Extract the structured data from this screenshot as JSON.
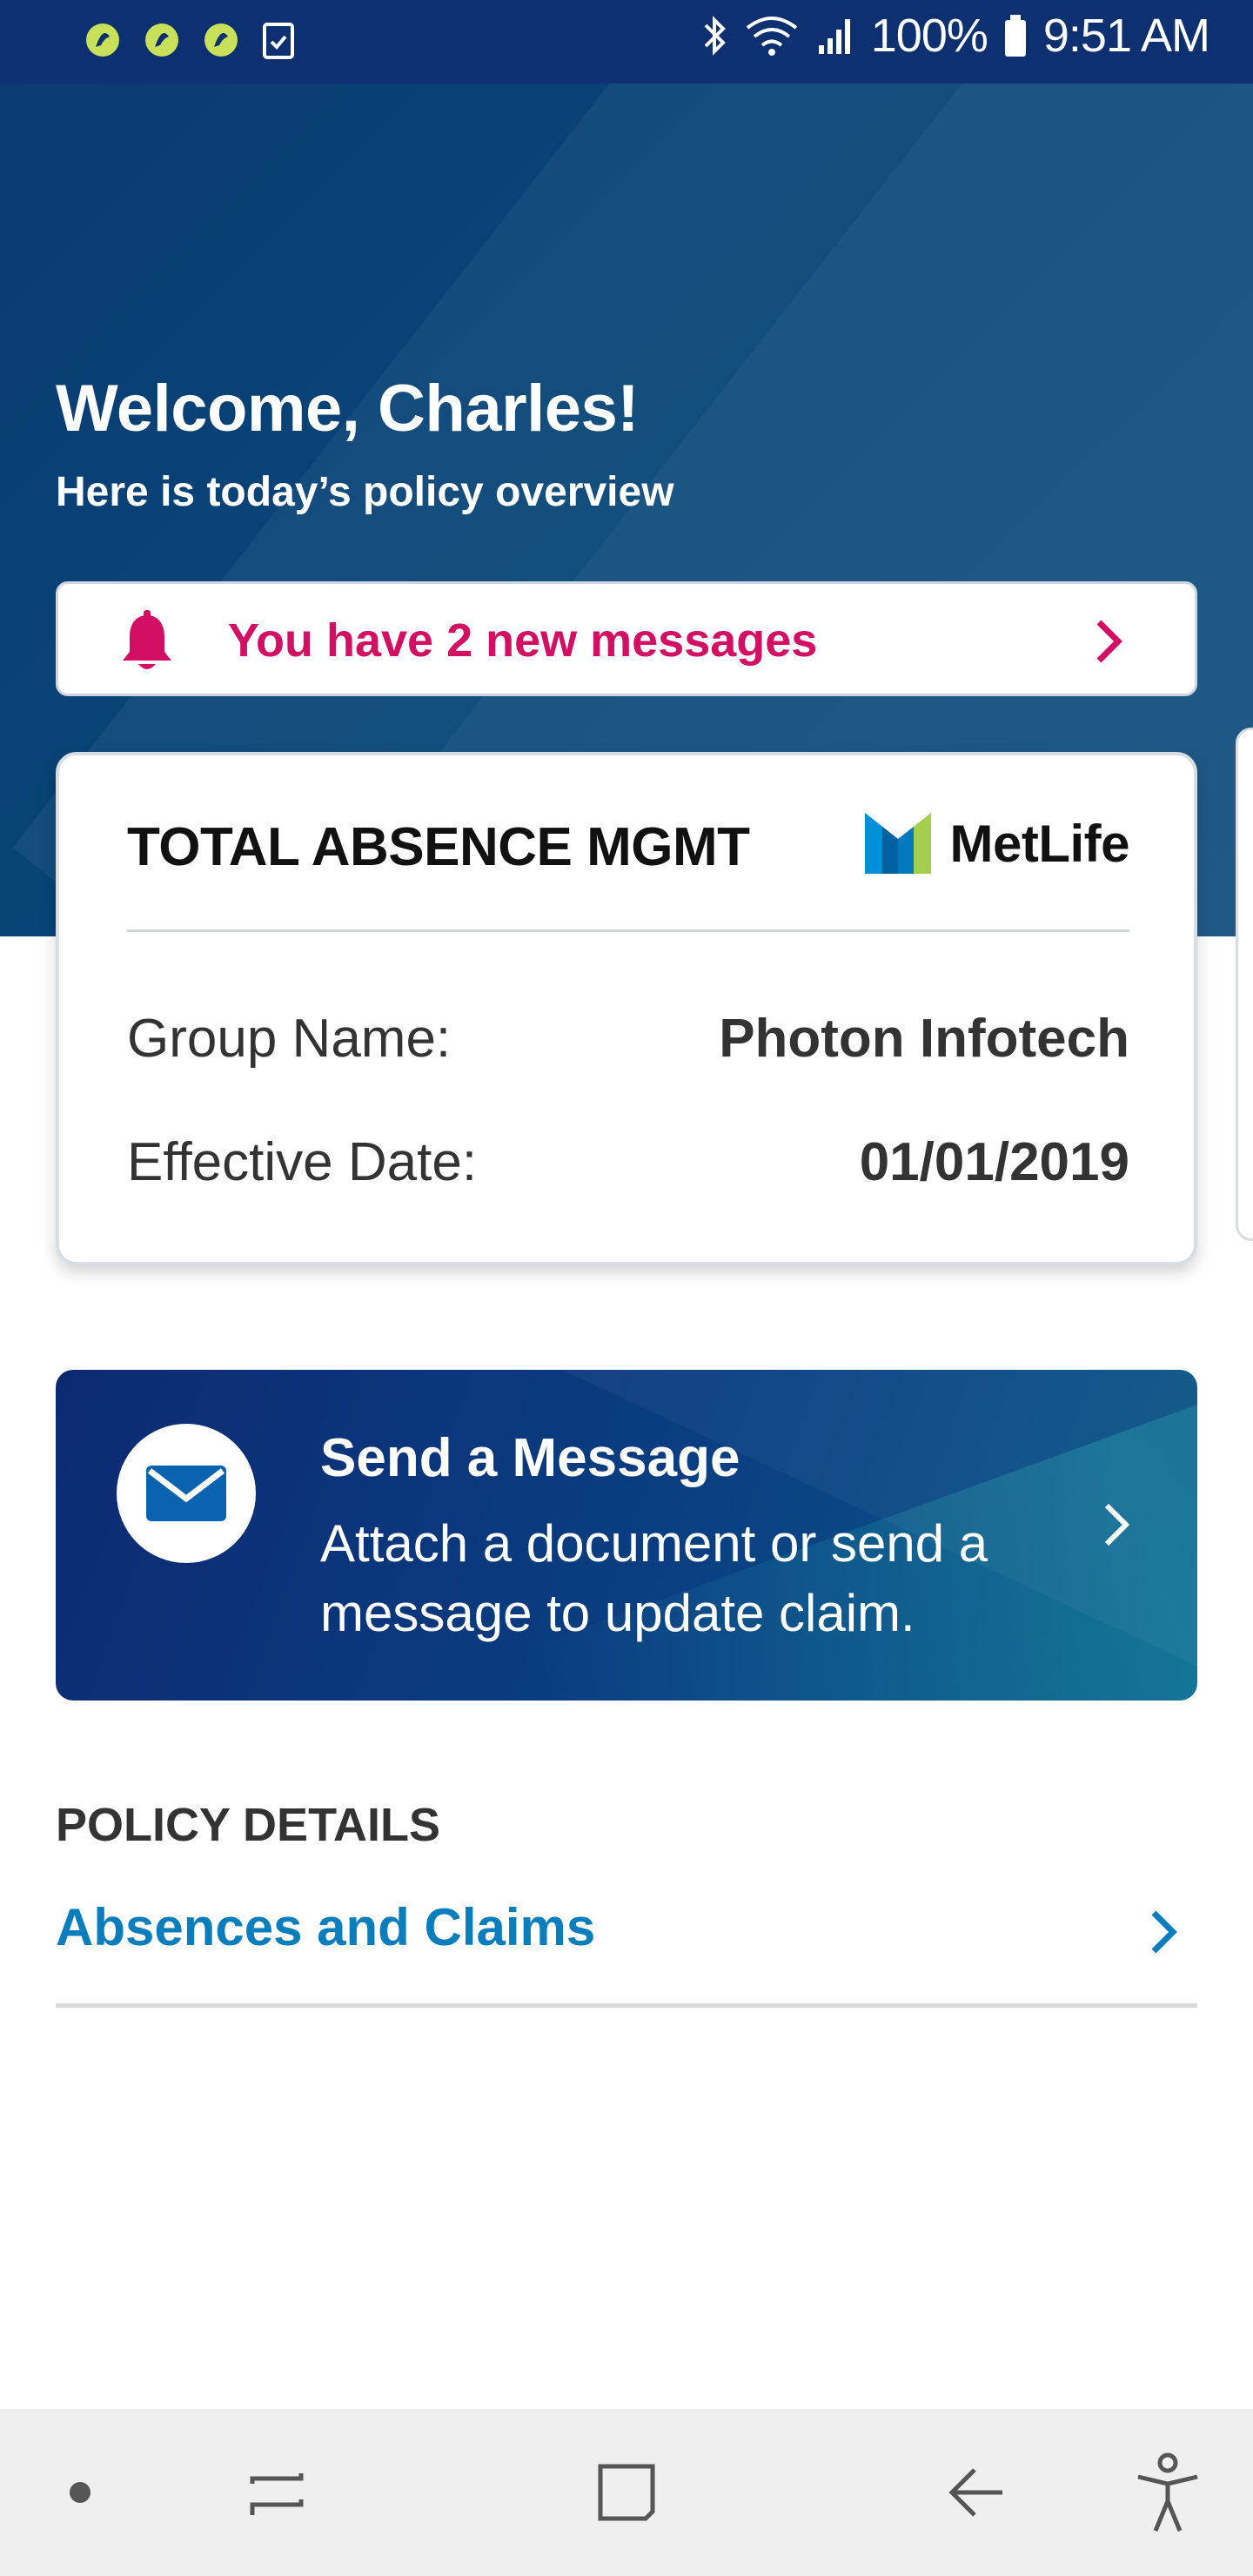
{
  "status_bar": {
    "battery": "100%",
    "time": "9:51 AM",
    "left_icons": [
      "app-notification-icon",
      "app-notification-icon",
      "app-notification-icon",
      "clipboard-check-icon"
    ],
    "right_icons": [
      "bluetooth-icon",
      "wifi-icon",
      "signal-icon",
      "battery-icon"
    ]
  },
  "header": {
    "welcome": "Welcome, Charles!",
    "subtitle": "Here is today’s policy overview"
  },
  "messages_banner": {
    "text": "You have 2 new messages",
    "icon": "bell-icon",
    "accent_color": "#d20f63"
  },
  "policy_card": {
    "title": "TOTAL ABSENCE MGMT",
    "brand": "MetLife",
    "rows": [
      {
        "label": "Group Name:",
        "value": "Photon Infotech"
      },
      {
        "label": "Effective Date:",
        "value": "01/01/2019"
      }
    ]
  },
  "send_message": {
    "title": "Send a Message",
    "description": "Attach a document or send a message to update claim.",
    "icon": "envelope-icon"
  },
  "policy_details": {
    "heading": "POLICY DETAILS",
    "items": [
      {
        "label": "Absences and Claims",
        "color": "#0a7dbd"
      }
    ]
  },
  "nav_bar": {
    "items": [
      "dot-icon",
      "recent-apps-icon",
      "home-icon",
      "back-icon",
      "accessibility-icon"
    ]
  },
  "colors": {
    "status_bar": "#0c3070",
    "hero": "#0b3b73",
    "link": "#0a7dbd",
    "alert": "#d20f63"
  }
}
